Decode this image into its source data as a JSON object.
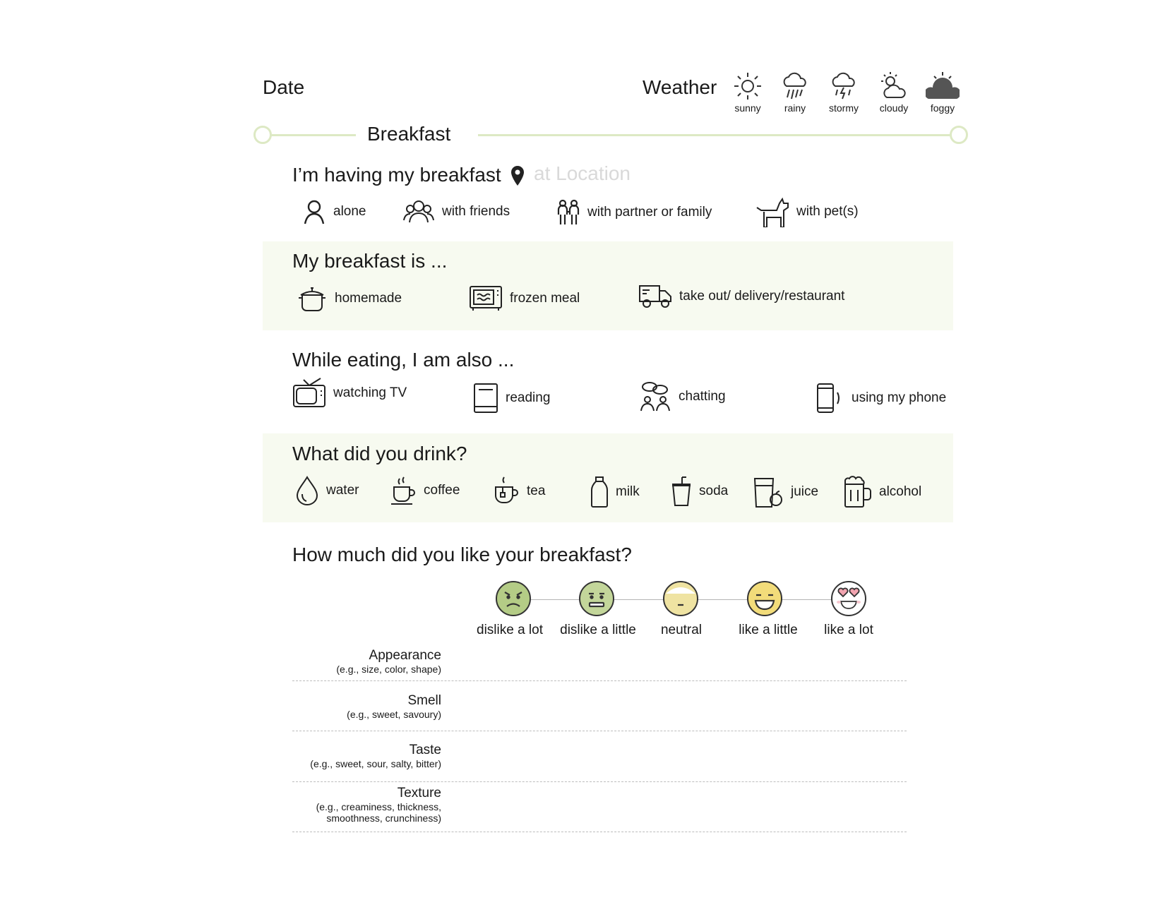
{
  "header": {
    "date_label": "Date",
    "weather_label": "Weather"
  },
  "weather": [
    {
      "label": "sunny",
      "icon": "sun-icon"
    },
    {
      "label": "rainy",
      "icon": "rain-cloud-icon"
    },
    {
      "label": "stormy",
      "icon": "storm-cloud-icon"
    },
    {
      "label": "cloudy",
      "icon": "sun-behind-cloud-icon"
    },
    {
      "label": "foggy",
      "icon": "fog-icon"
    }
  ],
  "section": {
    "title": "Breakfast",
    "accent_color": "#dde9c4",
    "band_color": "#f7faf0"
  },
  "company": {
    "heading": "I’m having my breakfast",
    "location_placeholder": "at Location",
    "options": [
      "alone",
      "with friends",
      "with partner or family",
      "with pet(s)"
    ]
  },
  "meal_type": {
    "heading": "My breakfast is ...",
    "options": [
      "homemade",
      "frozen meal",
      "take out/ delivery/restaurant"
    ]
  },
  "activities": {
    "heading": "While eating, I am also ...",
    "options": [
      "watching TV",
      "reading",
      "chatting",
      "using my phone"
    ]
  },
  "drinks": {
    "heading": "What did you drink?",
    "options": [
      "water",
      "coffee",
      "tea",
      "milk",
      "soda",
      "juice",
      "alcohol"
    ]
  },
  "rating": {
    "heading": "How much did you like your breakfast?",
    "scale": [
      "dislike a lot",
      "dislike a little",
      "neutral",
      "like a little",
      "like a lot"
    ],
    "rows": [
      {
        "label": "Appearance",
        "hint": "(e.g., size, color, shape)"
      },
      {
        "label": "Smell",
        "hint": "(e.g., sweet, savoury)"
      },
      {
        "label": "Taste",
        "hint": "(e.g., sweet, sour, salty, bitter)"
      },
      {
        "label": "Texture",
        "hint": "(e.g., creaminess, thickness,",
        "hint2": "smoothness, crunchiness)"
      }
    ]
  }
}
